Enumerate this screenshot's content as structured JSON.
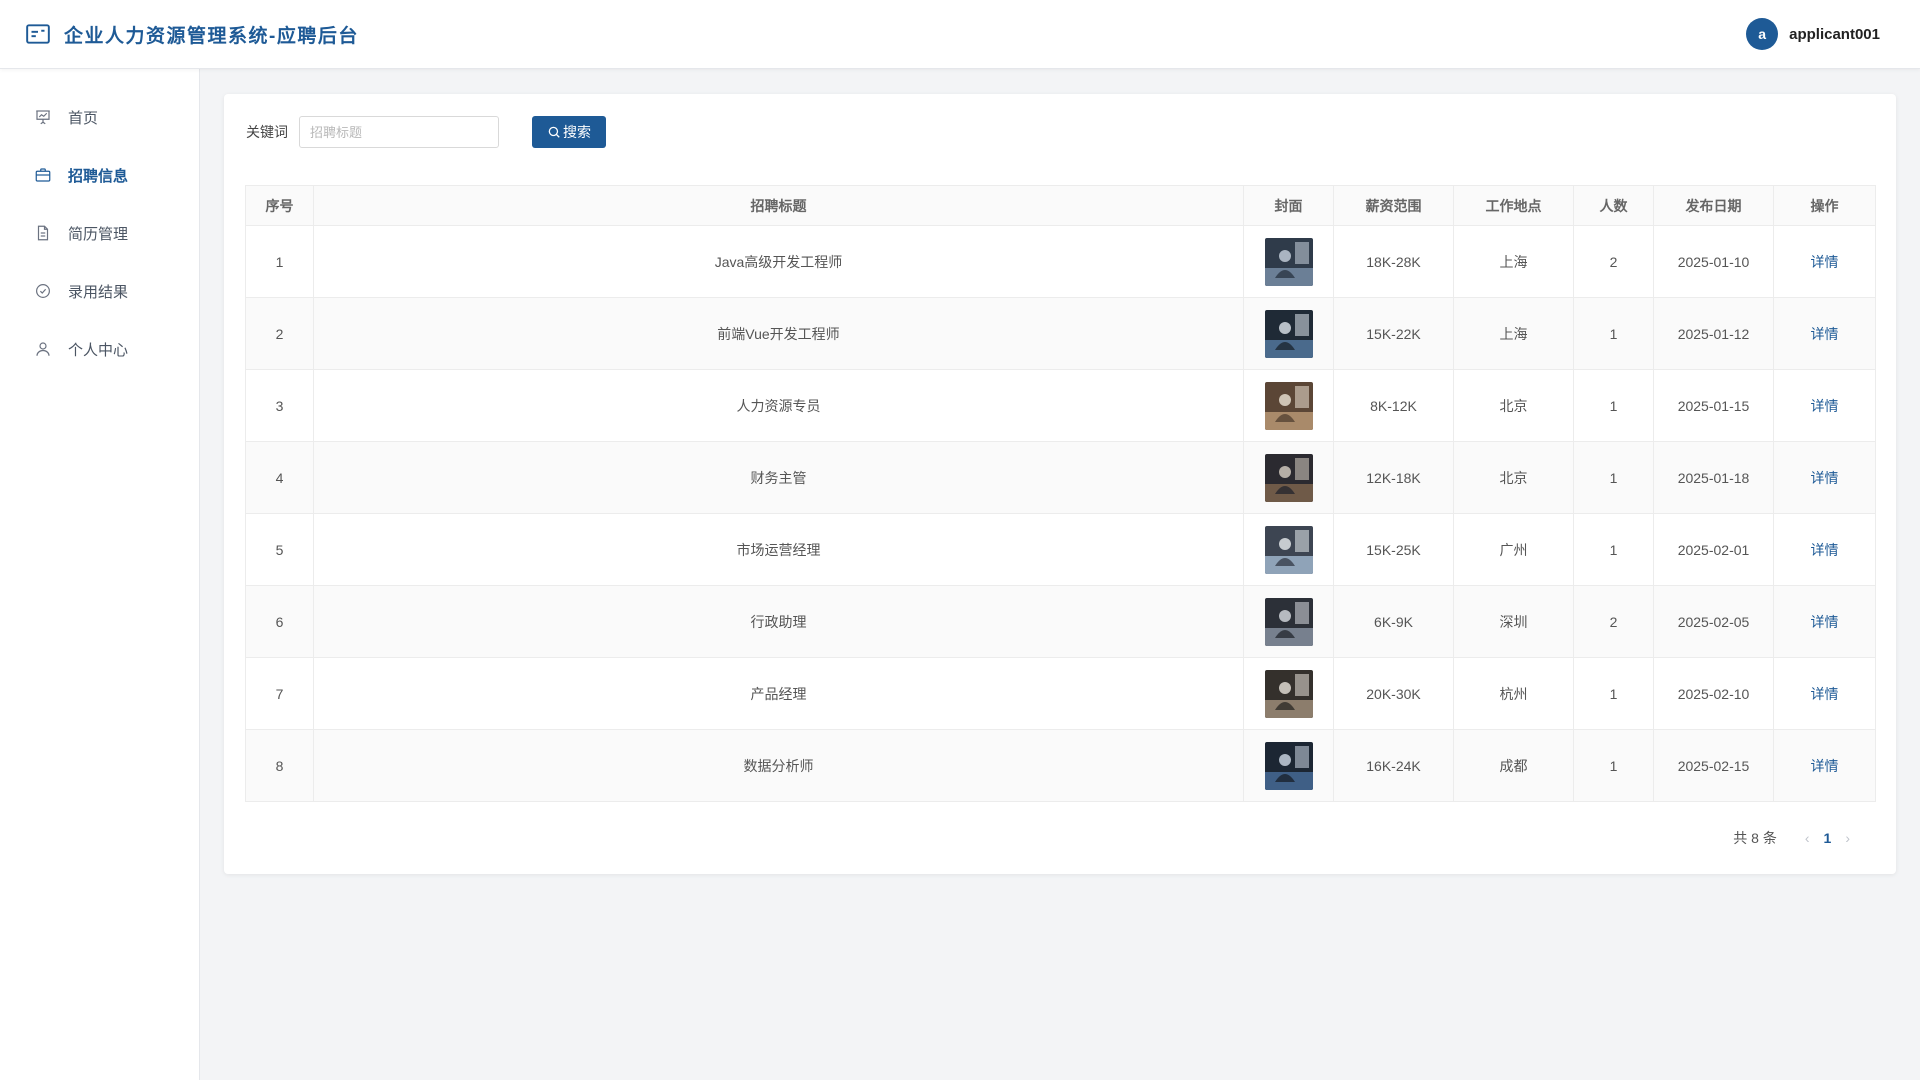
{
  "header": {
    "title": "企业人力资源管理系统-应聘后台",
    "user": {
      "avatar_letter": "a",
      "name": "applicant001"
    }
  },
  "sidebar": {
    "items": [
      {
        "label": "首页",
        "icon": "presentation-icon"
      },
      {
        "label": "招聘信息",
        "icon": "briefcase-icon",
        "active": true
      },
      {
        "label": "简历管理",
        "icon": "document-icon"
      },
      {
        "label": "录用结果",
        "icon": "check-circle-icon"
      },
      {
        "label": "个人中心",
        "icon": "user-icon"
      }
    ]
  },
  "search": {
    "label": "关键词",
    "placeholder": "招聘标题",
    "value": "",
    "button_label": "搜索"
  },
  "table": {
    "columns": [
      "序号",
      "招聘标题",
      "封面",
      "薪资范围",
      "工作地点",
      "人数",
      "发布日期",
      "操作"
    ],
    "action_label": "详情",
    "rows": [
      {
        "index": "1",
        "title": "Java高级开发工程师",
        "salary": "18K-28K",
        "location": "上海",
        "count": "2",
        "date": "2025-01-10"
      },
      {
        "index": "2",
        "title": "前端Vue开发工程师",
        "salary": "15K-22K",
        "location": "上海",
        "count": "1",
        "date": "2025-01-12"
      },
      {
        "index": "3",
        "title": "人力资源专员",
        "salary": "8K-12K",
        "location": "北京",
        "count": "1",
        "date": "2025-01-15"
      },
      {
        "index": "4",
        "title": "财务主管",
        "salary": "12K-18K",
        "location": "北京",
        "count": "1",
        "date": "2025-01-18"
      },
      {
        "index": "5",
        "title": "市场运营经理",
        "salary": "15K-25K",
        "location": "广州",
        "count": "1",
        "date": "2025-02-01"
      },
      {
        "index": "6",
        "title": "行政助理",
        "salary": "6K-9K",
        "location": "深圳",
        "count": "2",
        "date": "2025-02-05"
      },
      {
        "index": "7",
        "title": "产品经理",
        "salary": "20K-30K",
        "location": "杭州",
        "count": "1",
        "date": "2025-02-10"
      },
      {
        "index": "8",
        "title": "数据分析师",
        "salary": "16K-24K",
        "location": "成都",
        "count": "1",
        "date": "2025-02-15"
      }
    ]
  },
  "pagination": {
    "total_text": "共 8 条",
    "current_page": "1"
  },
  "colors": {
    "primary": "#1e5a96",
    "background": "#f3f4f6"
  }
}
